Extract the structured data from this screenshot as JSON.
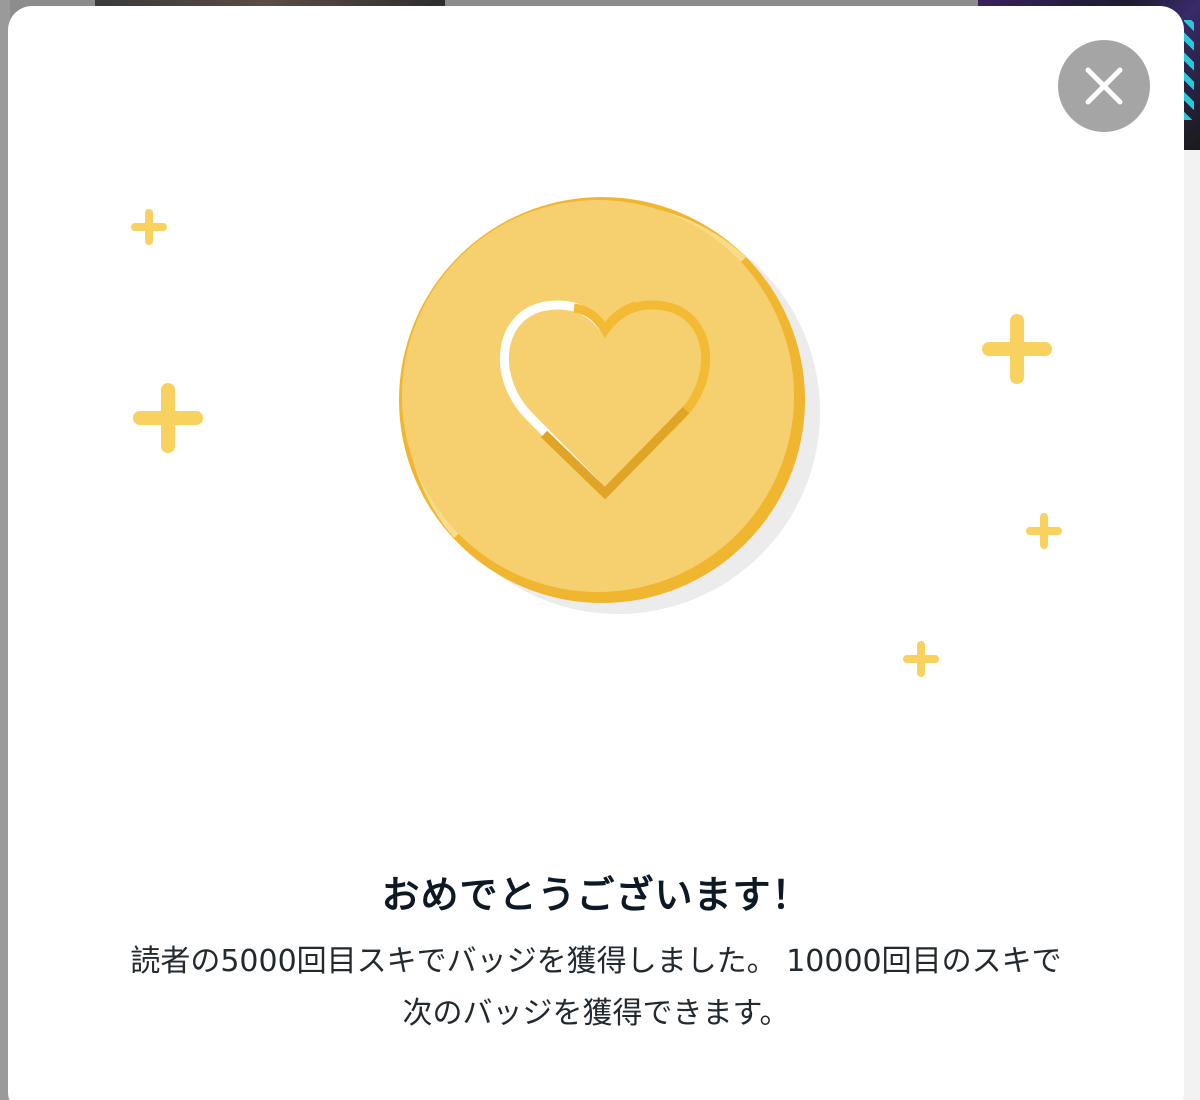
{
  "modal": {
    "close_icon": "close-icon",
    "badge_icon": "heart-coin-icon",
    "title": "おめでとうございます！",
    "message_line1": "読者の5000回目スキでバッジを獲得しました。 10000回目のスキで",
    "message_line2": "次のバッジを獲得できます。",
    "colors": {
      "coin": "#f6d06e",
      "coin_rim": "#f1b62f",
      "sparkle": "#f8d15e",
      "close_bg": "#a5a5a5",
      "title": "#0d1a26"
    }
  }
}
